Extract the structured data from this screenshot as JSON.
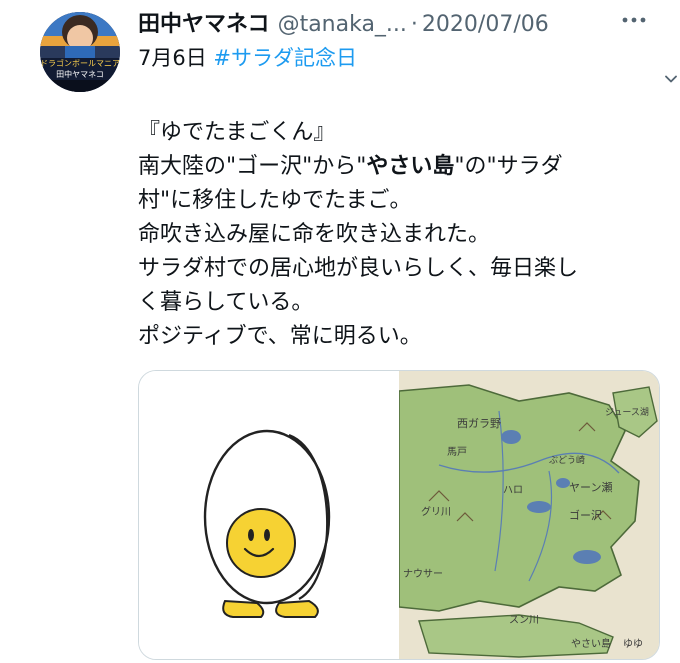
{
  "tweet": {
    "display_name": "田中ヤマネコ",
    "handle": "@tanaka_...",
    "separator": "·",
    "date": "2020/07/06",
    "date_prefix": "7月6日",
    "hashtag": "#サラダ記念日",
    "more_icon": "more-horizontal-icon",
    "body": {
      "line1": "『ゆでたまごくん』",
      "line2_pre": "南大陸の\"ゴー沢\"から\"",
      "line2_bold": "やさい島",
      "line2_post": "\"の\"サラダ",
      "line3": "村\"に移住したゆでたまご。",
      "line4": "命吹き込み屋に命を吹き込まれた。",
      "line5": "サラダ村での居心地が良いらしく、毎日楽し",
      "line6": "く暮らしている。",
      "line7": "ポジティブで、常に明るい。"
    },
    "media": [
      {
        "name": "boiled-egg-character-image"
      },
      {
        "name": "hand-drawn-island-map-image"
      }
    ]
  },
  "avatar": {
    "sign_text": "ドラゴンボールマニア",
    "sign_name": "田中ヤマネコ"
  },
  "map": {
    "labels": [
      "西ガラ野",
      "ぶどう崎",
      "ヤーン瀬",
      "ゴー沢",
      "ハロ",
      "グリ川",
      "スン川",
      "ナウサー",
      "やさい島",
      "ゆゆ",
      "ジュース湖",
      "馬戸"
    ]
  },
  "colors": {
    "accent": "#1d9bf0",
    "text": "#0f1419",
    "muted": "#536471",
    "egg_yolk": "#f6d233",
    "map_land": "#9fc07a",
    "map_sea": "#e9e3cf"
  }
}
